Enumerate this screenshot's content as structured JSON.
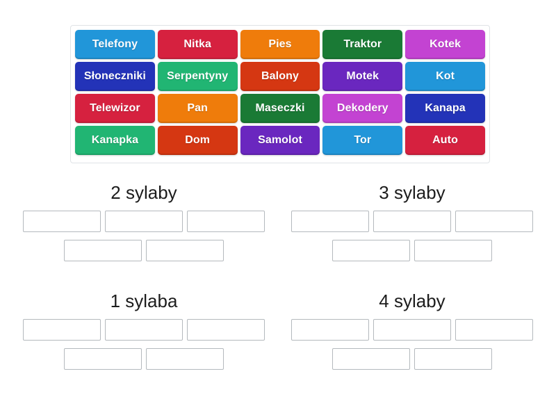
{
  "word_bank": {
    "rows": [
      [
        {
          "label": "Telefony",
          "color": "#2196d9"
        },
        {
          "label": "Nitka",
          "color": "#d6213f"
        },
        {
          "label": "Pies",
          "color": "#ef7c0b"
        },
        {
          "label": "Traktor",
          "color": "#1a7a35"
        },
        {
          "label": "Kotek",
          "color": "#c343d2"
        }
      ],
      [
        {
          "label": "Słoneczniki",
          "color": "#2333b8"
        },
        {
          "label": "Serpentyny",
          "color": "#21b573"
        },
        {
          "label": "Balony",
          "color": "#d53712"
        },
        {
          "label": "Motek",
          "color": "#6a27bf"
        },
        {
          "label": "Kot",
          "color": "#2196d9"
        }
      ],
      [
        {
          "label": "Telewizor",
          "color": "#d6213f"
        },
        {
          "label": "Pan",
          "color": "#ef7c0b"
        },
        {
          "label": "Maseczki",
          "color": "#1a7a35"
        },
        {
          "label": "Dekodery",
          "color": "#c343d2"
        },
        {
          "label": "Kanapa",
          "color": "#2333b8"
        }
      ],
      [
        {
          "label": "Kanapka",
          "color": "#21b573"
        },
        {
          "label": "Dom",
          "color": "#d53712"
        },
        {
          "label": "Samolot",
          "color": "#6a27bf"
        },
        {
          "label": "Tor",
          "color": "#2196d9"
        },
        {
          "label": "Auto",
          "color": "#d6213f"
        }
      ]
    ]
  },
  "groups": [
    {
      "id": "group-2sylaby",
      "title": "2 sylaby",
      "rows": [
        [
          "",
          "",
          ""
        ],
        [
          "",
          ""
        ]
      ]
    },
    {
      "id": "group-3sylaby",
      "title": "3 sylaby",
      "rows": [
        [
          "",
          "",
          ""
        ],
        [
          "",
          ""
        ]
      ]
    },
    {
      "id": "group-1sylaba",
      "title": "1 sylaba",
      "rows": [
        [
          "",
          "",
          ""
        ],
        [
          "",
          ""
        ]
      ]
    },
    {
      "id": "group-4sylaby",
      "title": "4 sylaby",
      "rows": [
        [
          "",
          "",
          ""
        ],
        [
          "",
          ""
        ]
      ]
    }
  ],
  "colors": {
    "page_background": "#ffffff",
    "bank_border": "#dfe3e6",
    "slot_border": "#b4b9bd",
    "title_text": "#1c1c1c",
    "tile_text": "#ffffff"
  }
}
